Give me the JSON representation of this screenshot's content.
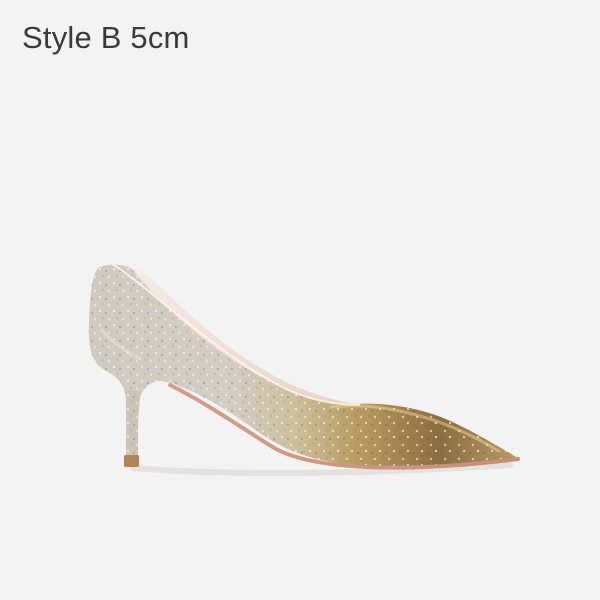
{
  "product": {
    "label": "Style B 5cm"
  },
  "image": {
    "subject": "glitter-pointed-toe-pump-icon",
    "colors": {
      "background": "#f3f3f3",
      "label": "#3a3a3a",
      "silver": "#cfcac2",
      "gold": "#b89a61",
      "sole": "#d19b86",
      "heel_tip": "#b0875a"
    }
  }
}
